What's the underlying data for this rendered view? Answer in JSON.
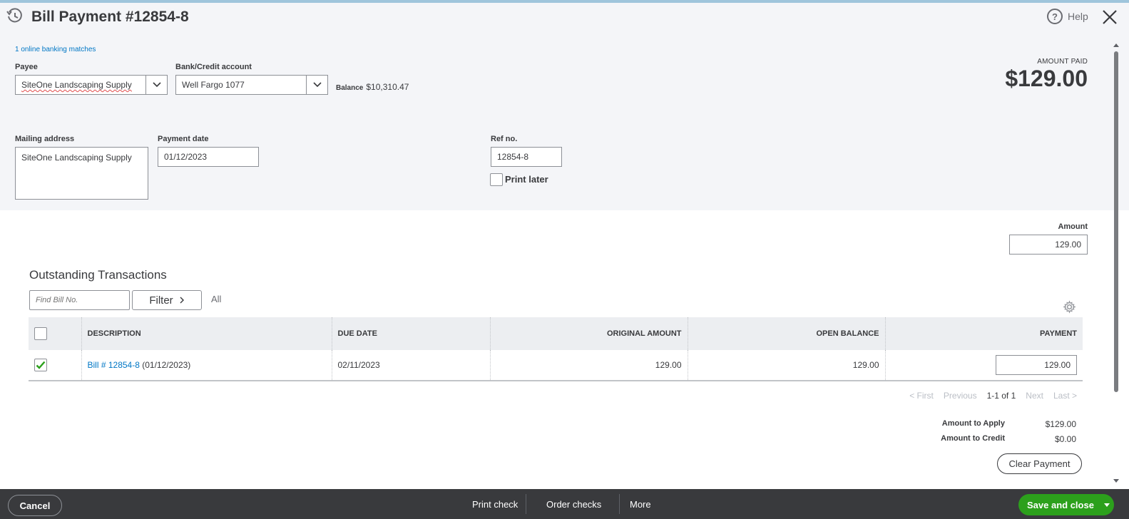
{
  "header": {
    "title": "Bill Payment #12854-8",
    "help_label": "Help",
    "banking_matches": "1 online banking matches"
  },
  "payee": {
    "label": "Payee",
    "value": "SiteOne Landscaping Supply"
  },
  "bank_account": {
    "label": "Bank/Credit account",
    "value": "Well Fargo 1077"
  },
  "balance": {
    "label": "Balance",
    "value": "$10,310.47"
  },
  "amount_paid": {
    "label": "AMOUNT PAID",
    "value": "$129.00"
  },
  "mailing_address": {
    "label": "Mailing address",
    "value": "SiteOne Landscaping Supply"
  },
  "payment_date": {
    "label": "Payment date",
    "value": "01/12/2023"
  },
  "ref_no": {
    "label": "Ref no.",
    "value": "12854-8"
  },
  "print_later": {
    "label": "Print later",
    "checked": false
  },
  "amount": {
    "label": "Amount",
    "value": "129.00"
  },
  "outstanding": {
    "title": "Outstanding Transactions",
    "search_placeholder": "Find Bill No.",
    "filter_label": "Filter",
    "filter_value": "All",
    "columns": {
      "description": "DESCRIPTION",
      "due_date": "DUE DATE",
      "original_amount": "ORIGINAL AMOUNT",
      "open_balance": "OPEN BALANCE",
      "payment": "PAYMENT"
    },
    "rows": [
      {
        "checked": true,
        "bill_link": "Bill # 12854-8",
        "bill_date": "(01/12/2023)",
        "due_date": "02/11/2023",
        "original_amount": "129.00",
        "open_balance": "129.00",
        "payment": "129.00"
      }
    ],
    "pager": {
      "first": "< First",
      "previous": "Previous",
      "range": "1-1 of 1",
      "next": "Next",
      "last": "Last >"
    }
  },
  "totals": {
    "apply_label": "Amount to Apply",
    "apply_value": "$129.00",
    "credit_label": "Amount to Credit",
    "credit_value": "$0.00",
    "clear_label": "Clear Payment"
  },
  "footer": {
    "cancel": "Cancel",
    "print_check": "Print check",
    "order_checks": "Order checks",
    "more": "More",
    "save_close": "Save and close"
  },
  "colors": {
    "link": "#0077c5",
    "save": "#2ca01c",
    "footer": "#393a3d",
    "check": "#2ca01c"
  },
  "icons": [
    "history-icon",
    "help-icon",
    "close-icon",
    "chevron-down-icon",
    "chevron-right-icon",
    "gear-icon",
    "checkmark-icon",
    "caret-down-icon"
  ]
}
